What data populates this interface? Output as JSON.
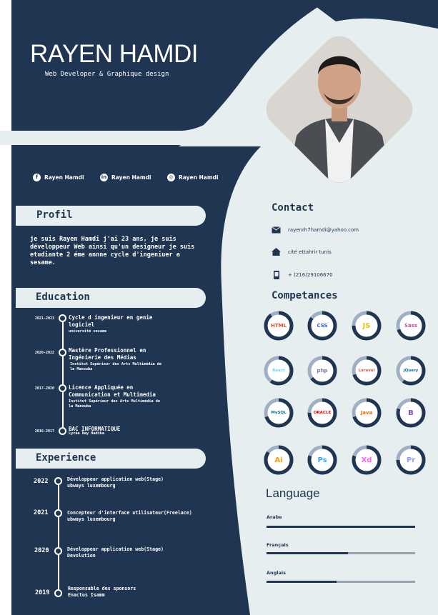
{
  "header": {
    "name": "RAYEN HAMDI",
    "subtitle": "Web Developer & Graphique design"
  },
  "colors": {
    "navy": "#1f3552",
    "light": "#e6eef0",
    "accent": "#9fb0c4"
  },
  "social": [
    {
      "icon": "facebook-icon",
      "label": "Rayen Hamdi"
    },
    {
      "icon": "linkedin-icon",
      "label": "Rayen Hamdi"
    },
    {
      "icon": "instagram-icon",
      "label": "Rayen Hamdi"
    }
  ],
  "profil": {
    "title": "Profil",
    "text": "je suis Rayen Hamdi j'ai 23 ans, je suis développeur Web ainsi qu'un designeur je suis etudiante 2 éme annne cycle d'ingeniuer a sesame."
  },
  "education": {
    "title": "Education",
    "items": [
      {
        "years": "2021-2023",
        "title": "Cycle d ingenieur en genie logiciel",
        "school": "université sesame"
      },
      {
        "years": "2020-2022",
        "title": "Mastère Professionnel en Ingénierie des Médias",
        "school": "Institut Supérieur des Arts Multimédia de la Manouba"
      },
      {
        "years": "2017-2020",
        "title": "Licence Appliquée en Communication et Multimedia",
        "school": "Institut Supérieur des Arts Multimédia de la Manouba"
      },
      {
        "years": "2016-2017",
        "title": "BAC INFORMATIQUE",
        "school": "Lycée Nay Hadika"
      }
    ]
  },
  "experience": {
    "title": "Experience",
    "items": [
      {
        "year": "2022",
        "role": "Développeur application web(Stage)",
        "company": "ubways luxembourg"
      },
      {
        "year": "2021",
        "role": "Concepteur d'interface utilisateur(Freelace)",
        "company": "ubways luxembourg"
      },
      {
        "year": "2020",
        "role": "Développeur application web(Stage)",
        "company": "Devolution"
      },
      {
        "year": "2019",
        "role": "Responsable des sponsors",
        "company": "Enactus Isamm"
      }
    ]
  },
  "contact": {
    "title": "Contact",
    "items": [
      {
        "icon": "mail-icon",
        "value": "rayenrh7hamdi@yahoo.com"
      },
      {
        "icon": "home-icon",
        "value": "cité ettahrir tunis"
      },
      {
        "icon": "phone-icon",
        "value": "+ (216)29106670"
      }
    ]
  },
  "competences": {
    "title": "Competances",
    "skills": [
      {
        "name": "HTML",
        "icon": "html5-icon",
        "level": 0.9,
        "color": "#e44d26"
      },
      {
        "name": "CSS",
        "icon": "css3-icon",
        "level": 0.85,
        "color": "#2965f1"
      },
      {
        "name": "JS",
        "icon": "javascript-icon",
        "level": 0.75,
        "color": "#e8c11c"
      },
      {
        "name": "Sass",
        "icon": "sass-icon",
        "level": 0.7,
        "color": "#c6538c"
      },
      {
        "name": "React",
        "icon": "react-icon",
        "level": 0.6,
        "color": "#61dafb"
      },
      {
        "name": "php",
        "icon": "php-icon",
        "level": 0.65,
        "color": "#777bb3"
      },
      {
        "name": "Laravel",
        "icon": "laravel-icon",
        "level": 0.7,
        "color": "#f05340"
      },
      {
        "name": "jQuery",
        "icon": "jquery-icon",
        "level": 0.6,
        "color": "#0769ad"
      },
      {
        "name": "MySQL",
        "icon": "mysql-icon",
        "level": 0.7,
        "color": "#00758f"
      },
      {
        "name": "ORACLE",
        "icon": "oracle-icon",
        "level": 0.75,
        "color": "#f80000"
      },
      {
        "name": "Java",
        "icon": "java-icon",
        "level": 0.7,
        "color": "#e76f00"
      },
      {
        "name": "B",
        "icon": "bootstrap-icon",
        "level": 0.8,
        "color": "#7952b3"
      },
      {
        "name": "Ai",
        "icon": "illustrator-icon",
        "level": 0.85,
        "color": "#ff9a00"
      },
      {
        "name": "Ps",
        "icon": "photoshop-icon",
        "level": 0.8,
        "color": "#31a8ff"
      },
      {
        "name": "Xd",
        "icon": "xd-icon",
        "level": 0.8,
        "color": "#ff61f6"
      },
      {
        "name": "Pr",
        "icon": "premiere-icon",
        "level": 0.75,
        "color": "#9999ff"
      }
    ]
  },
  "language": {
    "title": "Language",
    "items": [
      {
        "name": "Arabe",
        "level": 1.0
      },
      {
        "name": "Français",
        "level": 0.55
      },
      {
        "name": "Anglais",
        "level": 0.47
      }
    ]
  }
}
